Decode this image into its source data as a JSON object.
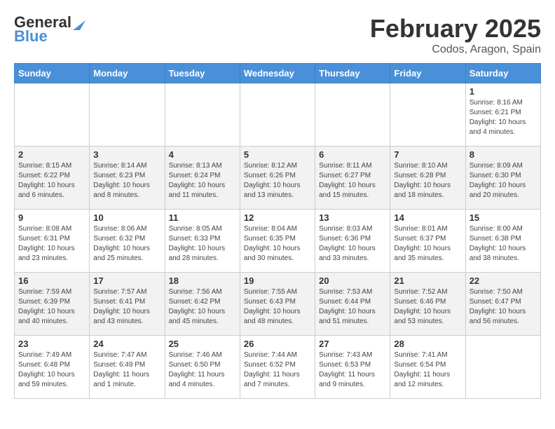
{
  "header": {
    "logo_line1": "General",
    "logo_line2": "Blue",
    "title": "February 2025",
    "subtitle": "Codos, Aragon, Spain"
  },
  "days_of_week": [
    "Sunday",
    "Monday",
    "Tuesday",
    "Wednesday",
    "Thursday",
    "Friday",
    "Saturday"
  ],
  "weeks": [
    [
      {
        "day": "",
        "info": ""
      },
      {
        "day": "",
        "info": ""
      },
      {
        "day": "",
        "info": ""
      },
      {
        "day": "",
        "info": ""
      },
      {
        "day": "",
        "info": ""
      },
      {
        "day": "",
        "info": ""
      },
      {
        "day": "1",
        "info": "Sunrise: 8:16 AM\nSunset: 6:21 PM\nDaylight: 10 hours and 4 minutes."
      }
    ],
    [
      {
        "day": "2",
        "info": "Sunrise: 8:15 AM\nSunset: 6:22 PM\nDaylight: 10 hours and 6 minutes."
      },
      {
        "day": "3",
        "info": "Sunrise: 8:14 AM\nSunset: 6:23 PM\nDaylight: 10 hours and 8 minutes."
      },
      {
        "day": "4",
        "info": "Sunrise: 8:13 AM\nSunset: 6:24 PM\nDaylight: 10 hours and 11 minutes."
      },
      {
        "day": "5",
        "info": "Sunrise: 8:12 AM\nSunset: 6:26 PM\nDaylight: 10 hours and 13 minutes."
      },
      {
        "day": "6",
        "info": "Sunrise: 8:11 AM\nSunset: 6:27 PM\nDaylight: 10 hours and 15 minutes."
      },
      {
        "day": "7",
        "info": "Sunrise: 8:10 AM\nSunset: 6:28 PM\nDaylight: 10 hours and 18 minutes."
      },
      {
        "day": "8",
        "info": "Sunrise: 8:09 AM\nSunset: 6:30 PM\nDaylight: 10 hours and 20 minutes."
      }
    ],
    [
      {
        "day": "9",
        "info": "Sunrise: 8:08 AM\nSunset: 6:31 PM\nDaylight: 10 hours and 23 minutes."
      },
      {
        "day": "10",
        "info": "Sunrise: 8:06 AM\nSunset: 6:32 PM\nDaylight: 10 hours and 25 minutes."
      },
      {
        "day": "11",
        "info": "Sunrise: 8:05 AM\nSunset: 6:33 PM\nDaylight: 10 hours and 28 minutes."
      },
      {
        "day": "12",
        "info": "Sunrise: 8:04 AM\nSunset: 6:35 PM\nDaylight: 10 hours and 30 minutes."
      },
      {
        "day": "13",
        "info": "Sunrise: 8:03 AM\nSunset: 6:36 PM\nDaylight: 10 hours and 33 minutes."
      },
      {
        "day": "14",
        "info": "Sunrise: 8:01 AM\nSunset: 6:37 PM\nDaylight: 10 hours and 35 minutes."
      },
      {
        "day": "15",
        "info": "Sunrise: 8:00 AM\nSunset: 6:38 PM\nDaylight: 10 hours and 38 minutes."
      }
    ],
    [
      {
        "day": "16",
        "info": "Sunrise: 7:59 AM\nSunset: 6:39 PM\nDaylight: 10 hours and 40 minutes."
      },
      {
        "day": "17",
        "info": "Sunrise: 7:57 AM\nSunset: 6:41 PM\nDaylight: 10 hours and 43 minutes."
      },
      {
        "day": "18",
        "info": "Sunrise: 7:56 AM\nSunset: 6:42 PM\nDaylight: 10 hours and 45 minutes."
      },
      {
        "day": "19",
        "info": "Sunrise: 7:55 AM\nSunset: 6:43 PM\nDaylight: 10 hours and 48 minutes."
      },
      {
        "day": "20",
        "info": "Sunrise: 7:53 AM\nSunset: 6:44 PM\nDaylight: 10 hours and 51 minutes."
      },
      {
        "day": "21",
        "info": "Sunrise: 7:52 AM\nSunset: 6:46 PM\nDaylight: 10 hours and 53 minutes."
      },
      {
        "day": "22",
        "info": "Sunrise: 7:50 AM\nSunset: 6:47 PM\nDaylight: 10 hours and 56 minutes."
      }
    ],
    [
      {
        "day": "23",
        "info": "Sunrise: 7:49 AM\nSunset: 6:48 PM\nDaylight: 10 hours and 59 minutes."
      },
      {
        "day": "24",
        "info": "Sunrise: 7:47 AM\nSunset: 6:49 PM\nDaylight: 11 hours and 1 minute."
      },
      {
        "day": "25",
        "info": "Sunrise: 7:46 AM\nSunset: 6:50 PM\nDaylight: 11 hours and 4 minutes."
      },
      {
        "day": "26",
        "info": "Sunrise: 7:44 AM\nSunset: 6:52 PM\nDaylight: 11 hours and 7 minutes."
      },
      {
        "day": "27",
        "info": "Sunrise: 7:43 AM\nSunset: 6:53 PM\nDaylight: 11 hours and 9 minutes."
      },
      {
        "day": "28",
        "info": "Sunrise: 7:41 AM\nSunset: 6:54 PM\nDaylight: 11 hours and 12 minutes."
      },
      {
        "day": "",
        "info": ""
      }
    ]
  ]
}
